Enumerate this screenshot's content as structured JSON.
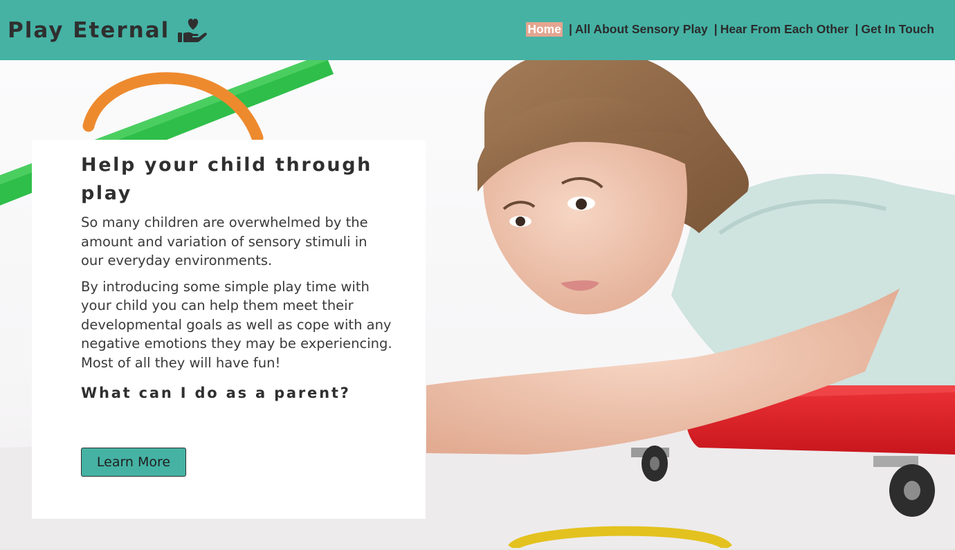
{
  "header": {
    "brand": "Play Eternal",
    "brand_icon": "hand-holding-heart-icon",
    "nav": [
      {
        "label": "Home",
        "active": true
      },
      {
        "label": "All About Sensory Play",
        "active": false
      },
      {
        "label": "Hear From Each Other",
        "active": false
      },
      {
        "label": "Get In Touch",
        "active": false
      }
    ],
    "separator": "|"
  },
  "hero": {
    "title": "Help your child through play",
    "paragraphs": [
      "So many children are overwhelmed by the amount and variation of sensory stimuli in our everyday environments.",
      "By introducing some simple play time with your child you can help them meet their developmental goals as well as cope with any negative emotions they may be experiencing. Most of all they will have fun!"
    ],
    "subtitle": "What can I do as a parent?",
    "button_label": "Learn More"
  },
  "colors": {
    "header_bg": "#45b2a4",
    "active_nav_bg": "#e3a590",
    "button_bg": "#45b2a4",
    "card_bg": "#ffffff"
  }
}
